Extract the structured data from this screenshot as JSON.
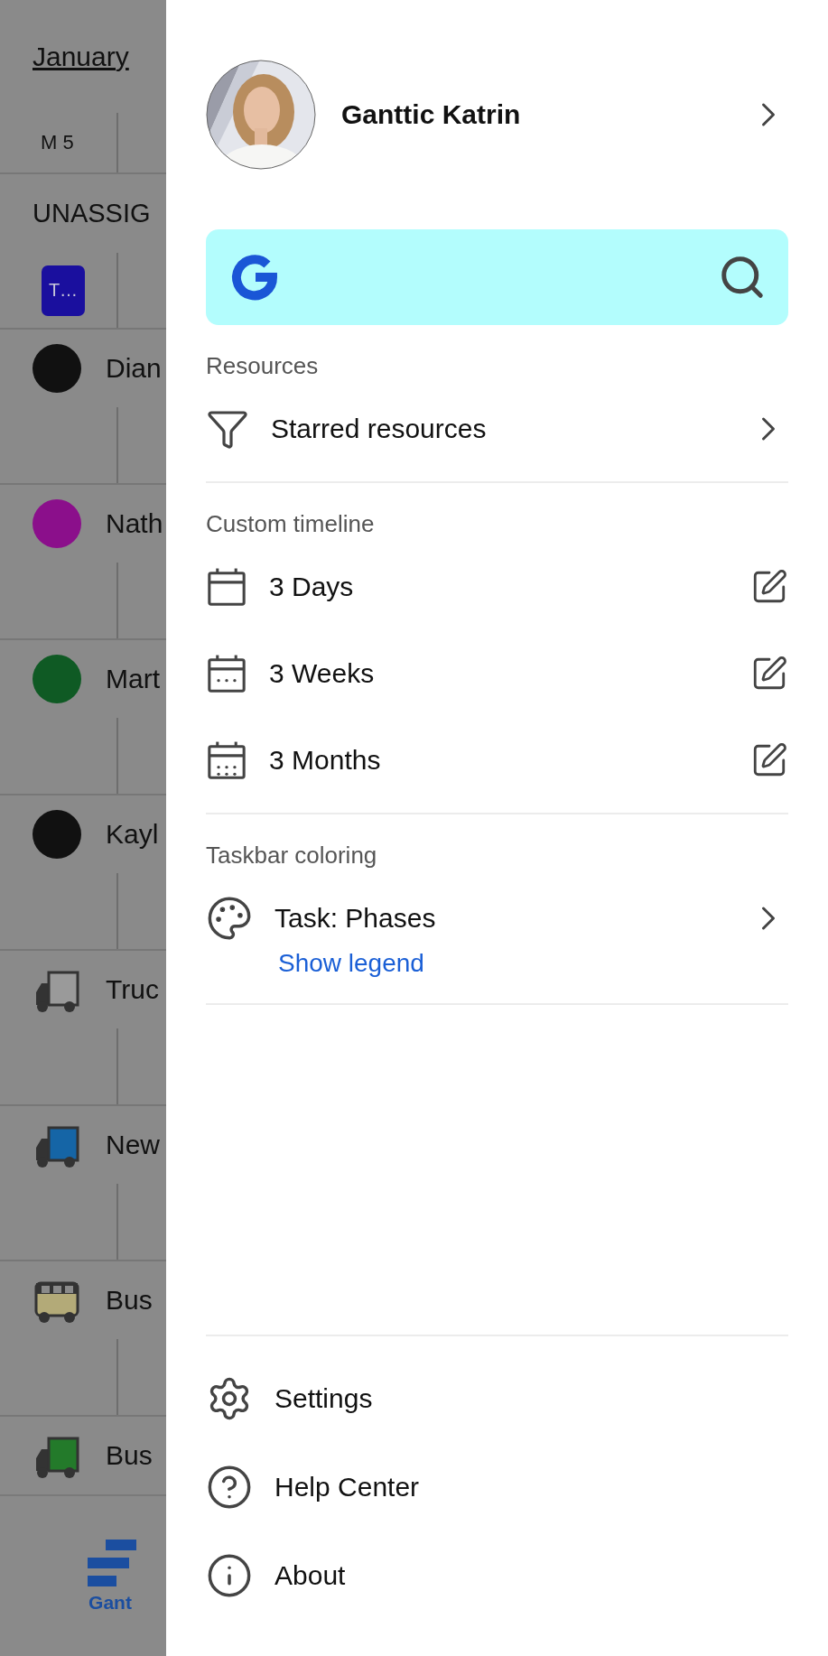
{
  "background": {
    "month": "January",
    "day_columns": [
      "M 5"
    ],
    "unassigned": {
      "label": "UNASSIG",
      "task": "T…",
      "color": "#1a0f9e"
    },
    "resources": [
      {
        "name": "Dian",
        "kind": "person",
        "color": "#111111"
      },
      {
        "name": "Nath",
        "kind": "person",
        "color": "#8b0f8b"
      },
      {
        "name": "Mart",
        "kind": "person",
        "color": "#0f5a24"
      },
      {
        "name": "Kayl",
        "kind": "person",
        "color": "#111111"
      },
      {
        "name": "Truc",
        "kind": "truck",
        "color": "#9a9a9a"
      },
      {
        "name": "New",
        "kind": "truck",
        "color": "#1565a6"
      },
      {
        "name": "Bus",
        "kind": "bus",
        "color": "#b3aa78"
      },
      {
        "name": "Bus",
        "kind": "truck",
        "color": "#237a2a"
      }
    ],
    "bottom_nav": {
      "label": "Gant",
      "selected": true
    }
  },
  "drawer": {
    "profile": {
      "name": "Ganttic Katrin"
    },
    "sections": [
      {
        "title": "Resources",
        "items": [
          {
            "label": "Starred resources",
            "kind": "filter"
          }
        ]
      },
      {
        "title": "Custom timeline",
        "items": [
          {
            "label": "3 Days",
            "kind": "days"
          },
          {
            "label": "3 Weeks",
            "kind": "weeks"
          },
          {
            "label": "3 Months",
            "kind": "months"
          }
        ]
      },
      {
        "title": "Taskbar coloring",
        "items": [
          {
            "label": "Task: Phases",
            "kind": "palette",
            "link": "Show legend"
          }
        ]
      }
    ],
    "footer": [
      {
        "label": "Settings",
        "kind": "settings"
      },
      {
        "label": "Help Center",
        "kind": "help"
      },
      {
        "label": "About",
        "kind": "about"
      }
    ]
  }
}
